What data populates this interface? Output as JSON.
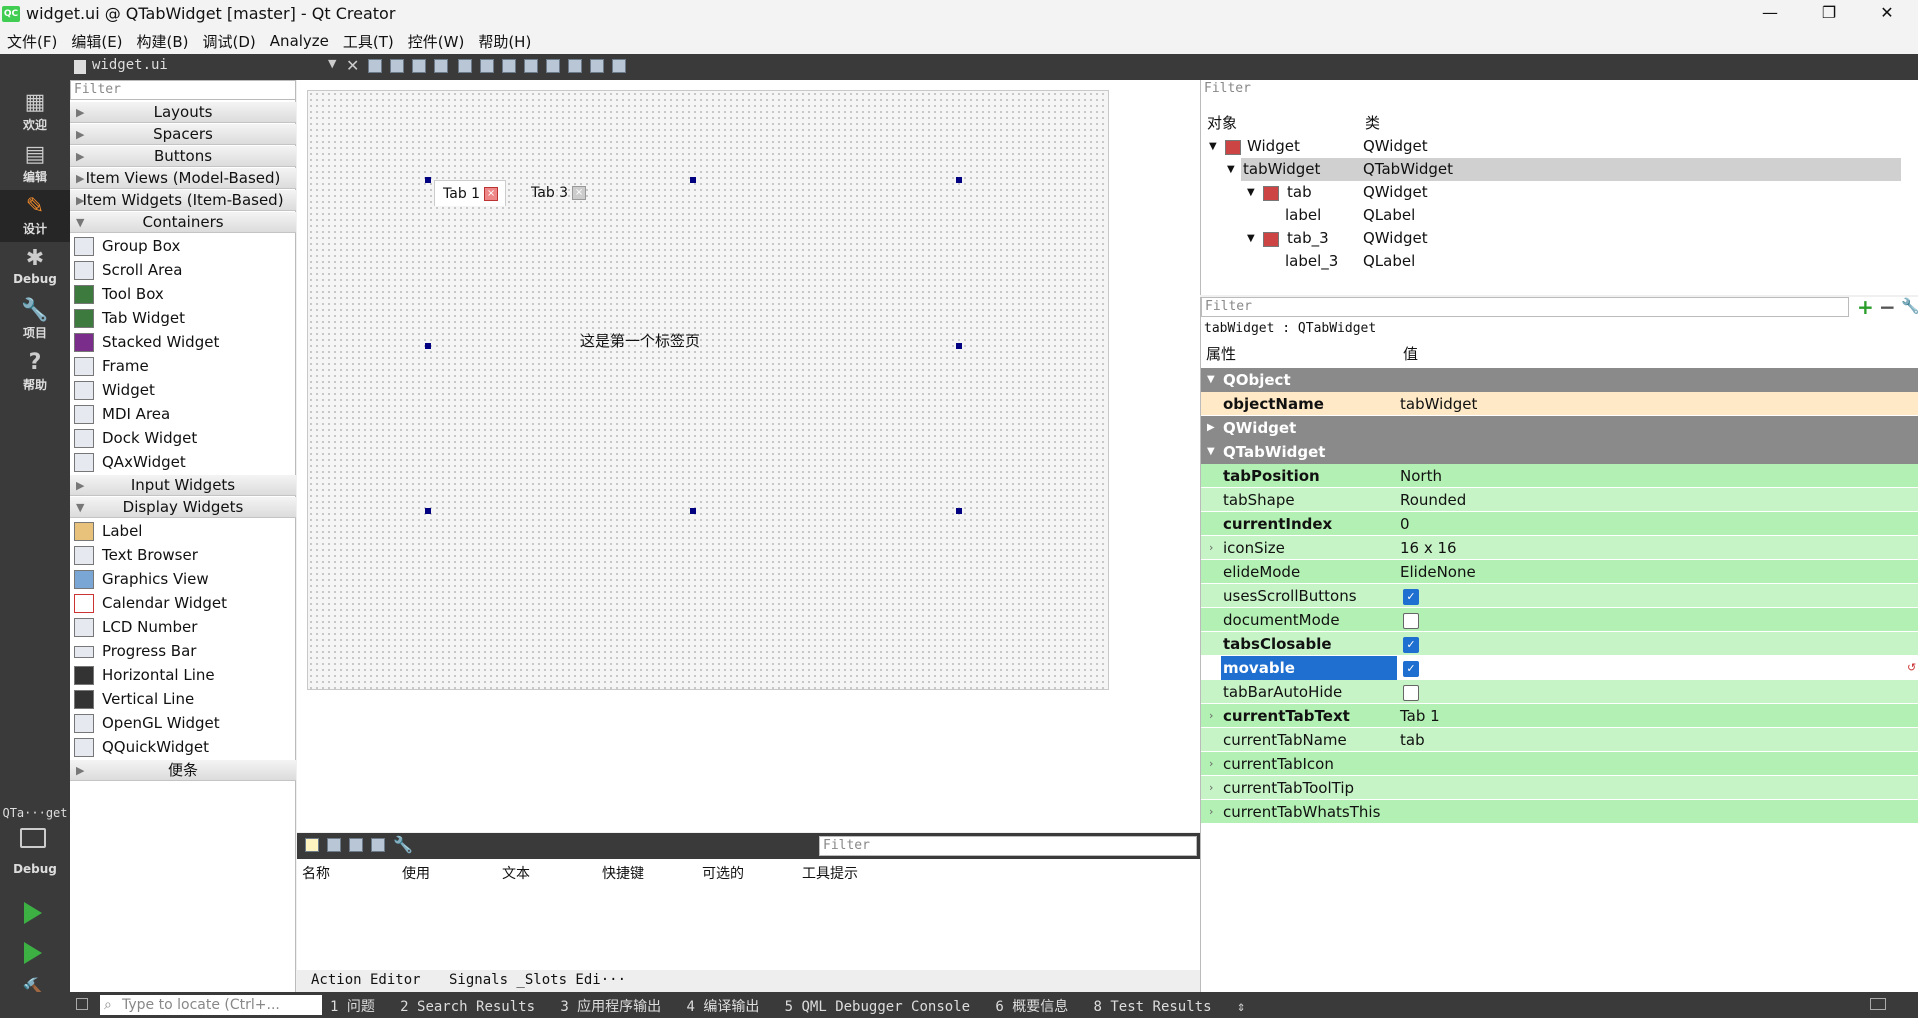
{
  "window": {
    "title": "widget.ui @ QTabWidget [master] - Qt Creator",
    "app_icon_text": "QC",
    "controls": [
      "—",
      "❐",
      "✕"
    ]
  },
  "menubar": [
    "文件(F)",
    "编辑(E)",
    "构建(B)",
    "调试(D)",
    "Analyze",
    "工具(T)",
    "控件(W)",
    "帮助(H)"
  ],
  "document": {
    "filename": "widget.ui"
  },
  "modes": [
    {
      "icon": "▦",
      "label": "欢迎"
    },
    {
      "icon": "▤",
      "label": "编辑"
    },
    {
      "icon": "✎",
      "label": "设计"
    },
    {
      "icon": "✱",
      "label": "Debug"
    },
    {
      "icon": "🔧",
      "label": "项目"
    },
    {
      "icon": "?",
      "label": "帮助"
    }
  ],
  "kit": {
    "label": "QTa···get",
    "sub": "Debug"
  },
  "widgetbox": {
    "filter_placeholder": "Filter",
    "cat_layouts": "Layouts",
    "cat_spacers": "Spacers",
    "cat_buttons": "Buttons",
    "cat_itemviews": "Item Views (Model-Based)",
    "cat_itemwidgets": "Item Widgets (Item-Based)",
    "cat_containers": "Containers",
    "containers": [
      "Group Box",
      "Scroll Area",
      "Tool Box",
      "Tab Widget",
      "Stacked Widget",
      "Frame",
      "Widget",
      "MDI Area",
      "Dock Widget",
      "QAxWidget"
    ],
    "cat_input": "Input Widgets",
    "cat_display": "Display Widgets",
    "display": [
      "Label",
      "Text Browser",
      "Graphics View",
      "Calendar Widget",
      "LCD Number",
      "Progress Bar",
      "Horizontal Line",
      "Vertical Line",
      "OpenGL Widget",
      "QQuickWidget"
    ],
    "cat_misc": "便条"
  },
  "form": {
    "tab1": "Tab 1",
    "tab3": "Tab 3",
    "content": "这是第一个标签页"
  },
  "action_editor": {
    "filter_placeholder": "Filter",
    "columns": [
      "名称",
      "使用",
      "文本",
      "快捷键",
      "可选的",
      "工具提示"
    ],
    "tab_action": "Action Editor",
    "tab_signals": "Signals _Slots Edi···"
  },
  "object_inspector": {
    "filter_placeholder": "Filter",
    "col_object": "对象",
    "col_class": "类",
    "rows": [
      {
        "name": "Widget",
        "cls": "QWidget"
      },
      {
        "name": "tabWidget",
        "cls": "QTabWidget"
      },
      {
        "name": "tab",
        "cls": "QWidget"
      },
      {
        "name": "label",
        "cls": "QLabel"
      },
      {
        "name": "tab_3",
        "cls": "QWidget"
      },
      {
        "name": "label_3",
        "cls": "QLabel"
      }
    ]
  },
  "property_editor": {
    "filter_placeholder": "Filter",
    "caption": "tabWidget : QTabWidget",
    "col_prop": "属性",
    "col_value": "值",
    "group_qobject": "QObject",
    "objectName": {
      "name": "objectName",
      "value": "tabWidget"
    },
    "group_qwidget": "QWidget",
    "group_qtabwidget": "QTabWidget",
    "props": [
      {
        "name": "tabPosition",
        "value": "North"
      },
      {
        "name": "tabShape",
        "value": "Rounded"
      },
      {
        "name": "currentIndex",
        "value": "0"
      },
      {
        "name": "iconSize",
        "value": "16 x 16"
      },
      {
        "name": "elideMode",
        "value": "ElideNone"
      },
      {
        "name": "usesScrollButtons",
        "value": ""
      },
      {
        "name": "documentMode",
        "value": ""
      },
      {
        "name": "tabsClosable",
        "value": ""
      },
      {
        "name": "movable",
        "value": ""
      },
      {
        "name": "tabBarAutoHide",
        "value": ""
      },
      {
        "name": "currentTabText",
        "value": "Tab 1"
      },
      {
        "name": "currentTabName",
        "value": "tab"
      },
      {
        "name": "currentTabIcon",
        "value": ""
      },
      {
        "name": "currentTabToolTip",
        "value": ""
      },
      {
        "name": "currentTabWhatsThis",
        "value": ""
      }
    ],
    "checkboxes": {
      "usesScrollButtons": true,
      "documentMode": false,
      "tabsClosable": true,
      "movable": true,
      "tabBarAutoHide": false
    }
  },
  "statusbar": {
    "locator_placeholder": "Type to locate (Ctrl+...",
    "outputs": [
      "1 问题",
      "2 Search Results",
      "3 应用程序输出",
      "4 编译输出",
      "5 QML Debugger Console",
      "6 概要信息",
      "8 Test Results"
    ]
  },
  "colors": {
    "accent": "#1e6fd0",
    "prop_green": "#b3f0b3",
    "group_gray": "#8a8a8a",
    "dark_bar": "#3a3a3a"
  }
}
